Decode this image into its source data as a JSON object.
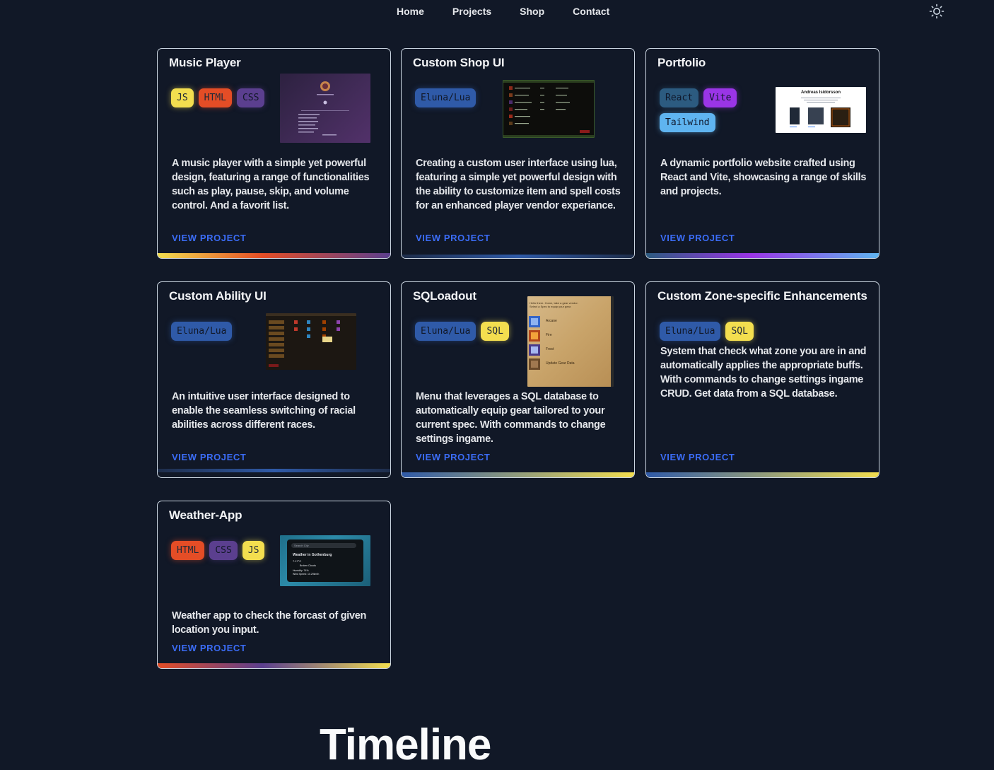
{
  "nav": {
    "links": [
      "Home",
      "Projects",
      "Shop",
      "Contact"
    ],
    "theme_icon": "sun-icon"
  },
  "projects": [
    {
      "title": "Music Player",
      "tags": [
        "JS",
        "HTML",
        "CSS"
      ],
      "description": "A music player with a simple yet powerful design, featuring a range of functionalities such as play, pause, skip, and volume control. And a favorit list.",
      "link": "VIEW PROJECT"
    },
    {
      "title": "Custom Shop UI",
      "tags": [
        "Eluna/Lua"
      ],
      "description": "Creating a custom user interface using lua, featuring a simple yet powerful design with the ability to customize item and spell costs for an enhanced player vendor experiance.",
      "link": "VIEW PROJECT"
    },
    {
      "title": "Portfolio",
      "tags": [
        "React",
        "Vite",
        "Tailwind"
      ],
      "description": "A dynamic portfolio website crafted using React and Vite, showcasing a range of skills and projects.",
      "link": "VIEW PROJECT",
      "thumb_heading": "Andreas Isidorsson"
    },
    {
      "title": "Custom Ability UI",
      "tags": [
        "Eluna/Lua"
      ],
      "description": "An intuitive user interface designed to enable the seamless switching of racial abilities across different races.",
      "link": "VIEW PROJECT"
    },
    {
      "title": "SQLoadout",
      "tags": [
        "Eluna/Lua",
        "SQL"
      ],
      "description": "Menu that leverages a SQL database to automatically equip gear tailored to your current spec. With commands to change settings ingame.",
      "link": "VIEW PROJECT",
      "thumb_lines": [
        "Hello there. Come, take a gear vendor.",
        "Select a Spec to equip your gear.",
        "Arcane",
        "Fire",
        "Frost",
        "Update Gear Data"
      ]
    },
    {
      "title": "Custom Zone-specific Enhancements",
      "tags": [
        "Eluna/Lua",
        "SQL"
      ],
      "description": "System that check what zone you are in and automatically applies the appropriate buffs. With commands to change settings ingame CRUD. Get data from a SQL database.",
      "link": "VIEW PROJECT"
    },
    {
      "title": "Weather-App",
      "tags": [
        "HTML",
        "CSS",
        "JS"
      ],
      "description": "Weather app to check the forcast of given location you input.",
      "link": "VIEW PROJECT",
      "thumb_lines": [
        "Search City",
        "Weather in Gothenburg",
        "7.17°C",
        "Broken Clouds",
        "Humidity: 74%",
        "Wind Speed: 10.29km/h"
      ]
    }
  ],
  "section_heading": "Timeline",
  "colors": {
    "background": "#111827",
    "link": "#3b6cf6",
    "tag_js": "#f3de4f",
    "tag_html": "#e44d26",
    "tag_css": "#5b3f8f",
    "tag_lua": "#2f5aa8",
    "tag_react": "#2c5b80",
    "tag_vite": "#9a35e6",
    "tag_tailwind": "#5fb4f0"
  }
}
